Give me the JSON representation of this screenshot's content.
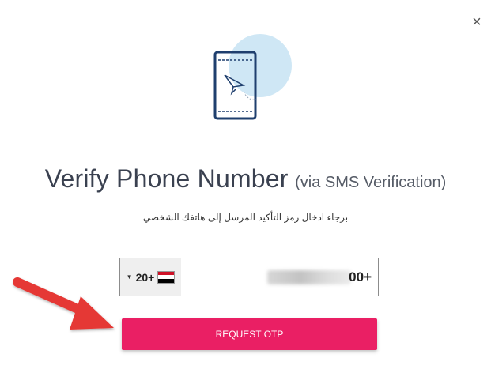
{
  "dialog": {
    "close_symbol": "×",
    "title": "Verify Phone Number",
    "title_suffix": "(via SMS Verification)",
    "subtitle": "برجاء ادخال رمز التأكيد المرسل إلى هاتفك الشخصي"
  },
  "phone": {
    "country_code": "20+",
    "number_suffix": "00+",
    "flag_colors": [
      "#ce1126",
      "#ffffff",
      "#000000"
    ]
  },
  "button": {
    "label": "REQUEST OTP",
    "color": "#ea1f64"
  },
  "annotation": {
    "arrow_color": "#e53935"
  },
  "icons": [
    "phone-send-icon",
    "close-icon",
    "caret-down-icon",
    "egypt-flag-icon",
    "arrow-annotation-icon"
  ]
}
